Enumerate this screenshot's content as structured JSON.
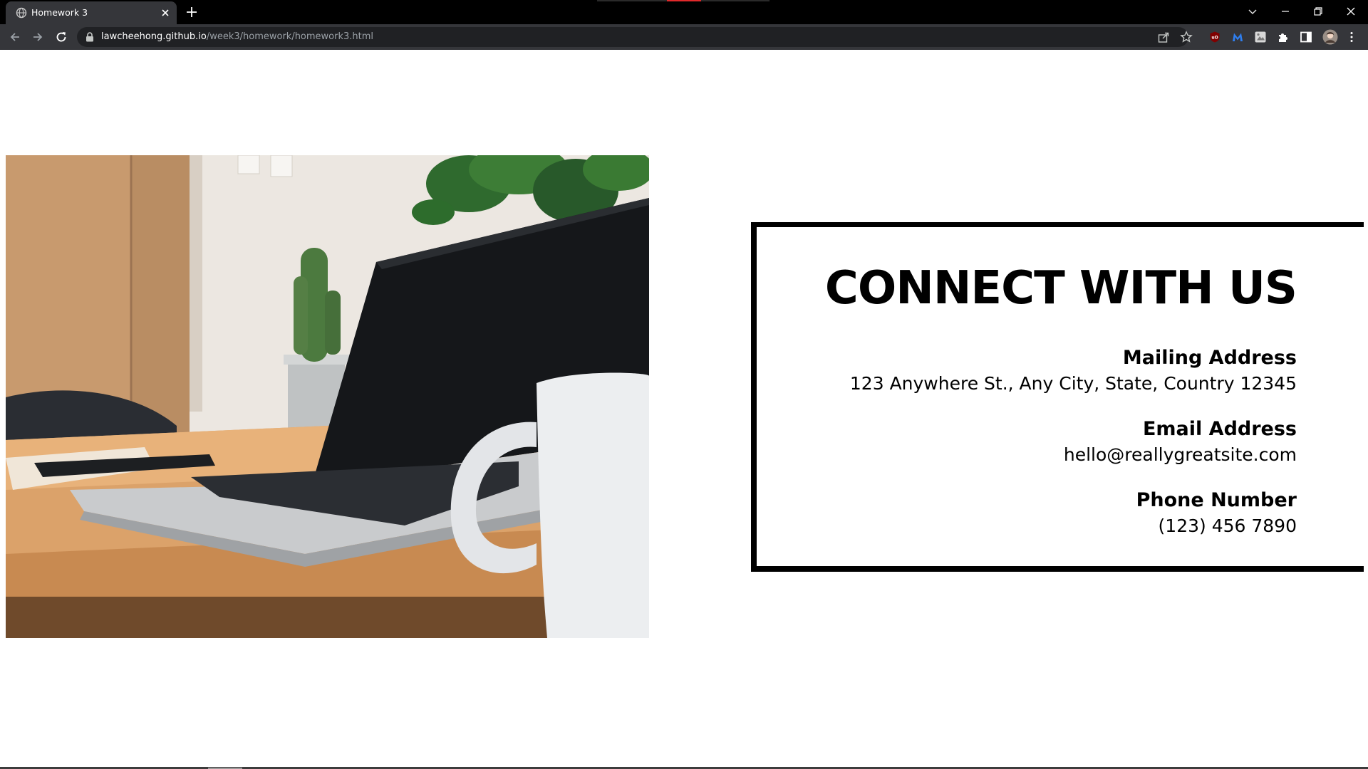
{
  "browser": {
    "tab_title": "Homework 3",
    "url_host": "lawcheehong.github.io",
    "url_path": "/week3/homework/homework3.html",
    "colors": {
      "frame": "#000000",
      "toolbar": "#35363a",
      "omnibox": "#202124",
      "recording_indicator": "#e0292b"
    },
    "icons": {
      "tab_favicon": "globe-icon",
      "tab_close": "close-icon",
      "new_tab": "plus-icon",
      "tab_search": "chevron-down-icon",
      "minimize": "minimize-icon",
      "restore": "restore-icon",
      "close_window": "close-icon",
      "back": "arrow-left-icon",
      "forward": "arrow-right-icon",
      "reload": "reload-icon",
      "lock": "lock-icon",
      "share": "share-icon",
      "bookmark": "star-icon",
      "extensions": [
        "ublock-icon",
        "malwarebytes-icon",
        "image-extension-icon",
        "puzzle-icon"
      ],
      "side_panel": "side-panel-icon",
      "profile": "avatar",
      "menu": "kebab-menu-icon"
    }
  },
  "page": {
    "hero_image": "photo of a laptop, white mug, smartphone and cactus on a wooden desk",
    "contact": {
      "heading": "CONNECT WITH US",
      "mailing_label": "Mailing Address",
      "mailing_value": "123 Anywhere St., Any City, State, Country 12345",
      "email_label": "Email Address",
      "email_value": "hello@reallygreatsite.com",
      "phone_label": "Phone Number",
      "phone_value": "(123) 456 7890"
    },
    "colors": {
      "background": "#ffffff",
      "text": "#000000",
      "border": "#000000"
    }
  }
}
